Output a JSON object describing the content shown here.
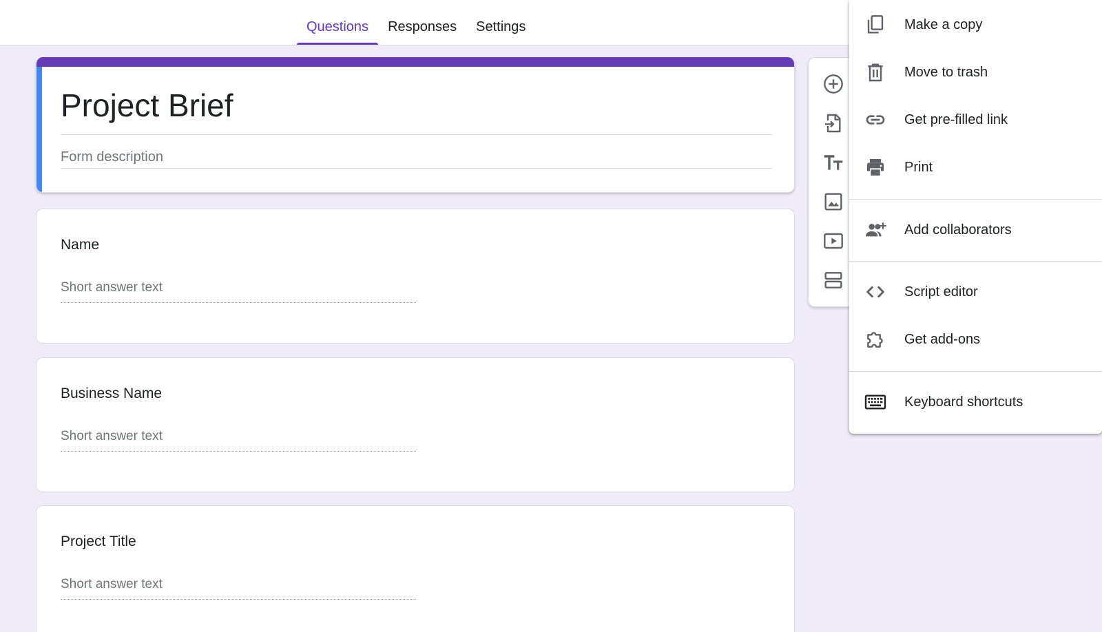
{
  "tabs": [
    {
      "label": "Questions",
      "active": true
    },
    {
      "label": "Responses",
      "active": false
    },
    {
      "label": "Settings",
      "active": false
    }
  ],
  "form": {
    "title": "Project Brief",
    "description_placeholder": "Form description"
  },
  "questions": [
    {
      "label": "Name",
      "placeholder": "Short answer text"
    },
    {
      "label": "Business Name",
      "placeholder": "Short answer text"
    },
    {
      "label": "Project Title",
      "placeholder": "Short answer text"
    }
  ],
  "toolbar": {
    "tools": [
      {
        "icon": "add-circle-icon",
        "action": "add-question"
      },
      {
        "icon": "import-file-icon",
        "action": "import-questions"
      },
      {
        "icon": "title-text-icon",
        "action": "add-title-and-description"
      },
      {
        "icon": "image-icon",
        "action": "add-image"
      },
      {
        "icon": "video-icon",
        "action": "add-video"
      },
      {
        "icon": "section-icon",
        "action": "add-section"
      }
    ]
  },
  "menu": {
    "items": [
      {
        "label": "Make a copy",
        "icon": "copy-icon"
      },
      {
        "label": "Move to trash",
        "icon": "trash-icon"
      },
      {
        "label": "Get pre-filled link",
        "icon": "link-icon"
      },
      {
        "label": "Print",
        "icon": "print-icon"
      },
      {
        "label": "Add collaborators",
        "icon": "add-people-icon"
      },
      {
        "label": "Script editor",
        "icon": "code-icon"
      },
      {
        "label": "Get add-ons",
        "icon": "puzzle-icon"
      },
      {
        "label": "Keyboard shortcuts",
        "icon": "keyboard-icon"
      }
    ]
  },
  "colors": {
    "accent": "#673ab7",
    "title_left_stripe": "#4285f4",
    "background": "#f0ebf8",
    "icon": "#5f6368"
  }
}
